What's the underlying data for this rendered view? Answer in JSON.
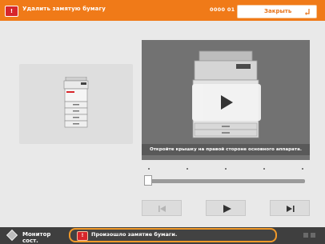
{
  "header": {
    "icon_label": "!",
    "title": "Удалить замятую бумагу",
    "code": "0000 01",
    "close_label": "Закрыть",
    "accent_color": "#f07a18"
  },
  "video": {
    "caption": "Откройте крышку на правой стороне основного аппарата.",
    "state_icon": "play-icon"
  },
  "slider": {
    "position": 0
  },
  "controls": {
    "prev": "skip-back-icon",
    "play": "play-icon",
    "next": "skip-forward-icon"
  },
  "statusbar": {
    "monitor_label": "Монитор сост.",
    "message_icon": "!",
    "message": "Произошло замятие бумаги.",
    "highlight_color": "#f29a2a"
  }
}
